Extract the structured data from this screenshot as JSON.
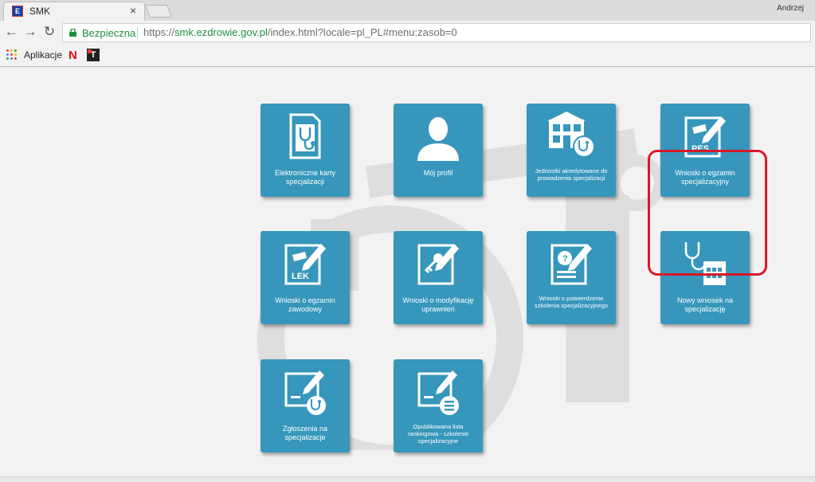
{
  "browser": {
    "tab_title": "SMK",
    "tab_favicon_text": "E",
    "tab_close": "×",
    "user_name": "Andrzej",
    "secure_label": "Bezpieczna",
    "url_scheme": "https://",
    "url_host": "smk.ezdrowie.gov.pl",
    "url_path": "/index.html?locale=pl_PL#menu:zasob=0",
    "back": "←",
    "forward": "→",
    "reload": "↻"
  },
  "bookmarks": {
    "apps_label": "Aplikacje",
    "netflix_label": "N",
    "t_label": "T",
    "apps_colors": [
      "#ea4335",
      "#fbbc05",
      "#34a853",
      "#4285f4",
      "#ea4335",
      "#fbbc05",
      "#34a853",
      "#4285f4",
      "#ea4335"
    ]
  },
  "colors": {
    "tile": "#3796bb",
    "highlight": "#d7192a"
  },
  "tiles": [
    {
      "label": "Elektroniczne karty specjalizacji",
      "icon": "medical-card-icon"
    },
    {
      "label": "Mój profil",
      "icon": "user-profile-icon"
    },
    {
      "label": "Jednostki akredytowane do prowadzenia specjalizacji",
      "icon": "accredited-units-icon"
    },
    {
      "label": "Wnioski o egzamin specjalizacyjny",
      "icon": "pes-exam-icon",
      "badge": "PES"
    },
    {
      "label": "Wnioski o egzamin zawodowy",
      "icon": "lek-exam-icon",
      "badge": "LEK"
    },
    {
      "label": "Wnioski o modyfikację uprawnień",
      "icon": "permissions-key-icon"
    },
    {
      "label": "Wnioski o potwierdzenie szkolenia specjalizacyjnego",
      "icon": "training-confirmation-icon"
    },
    {
      "label": "Nowy wniosek na specjalizację",
      "icon": "new-application-icon"
    },
    {
      "label": "Zgłoszenia na specjalizacje",
      "icon": "specialization-applications-icon"
    },
    {
      "label": "Opublikowana lista rankingowa - szkolenie specjalizacyjne",
      "icon": "ranking-list-icon"
    }
  ]
}
